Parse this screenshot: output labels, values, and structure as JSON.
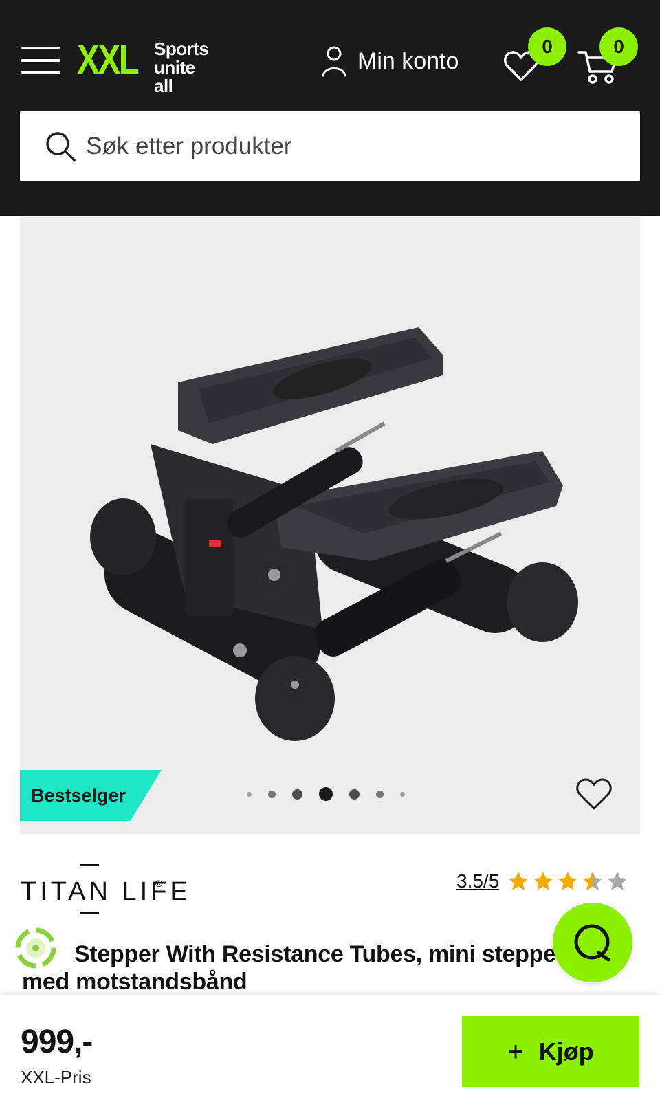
{
  "header": {
    "logo_mark": "XXL",
    "logo_tagline_1": "Sports",
    "logo_tagline_2": "unite all",
    "account_label": "Min konto",
    "wishlist_count": "0",
    "cart_count": "0",
    "icons": [
      "menu-icon",
      "user-icon",
      "heart-icon",
      "cart-icon"
    ]
  },
  "search": {
    "placeholder": "Søk etter produkter",
    "icon": "search-icon"
  },
  "gallery": {
    "badge": "Bestselger",
    "slide_count": 7,
    "active_slide": 4,
    "icon": "heart-icon"
  },
  "product": {
    "brand": "TITAN LIFE",
    "brand_mark": "®",
    "rating_text": "3.5/5",
    "rating_value": 3.5,
    "rating_max": 5,
    "title_line1": "Stepper With Resistance Tubes, mini stepper",
    "title_line2": "med motstandsbånd"
  },
  "purchase": {
    "price": "999,-",
    "price_label": "XXL-Pris",
    "buy_label": "Kjøp",
    "buy_icon": "plus-icon"
  },
  "colors": {
    "header_bg": "#1a1a1a",
    "brand_green": "#8cf000",
    "badge_teal": "#1fe6c6",
    "star_gold": "#f2a900"
  }
}
